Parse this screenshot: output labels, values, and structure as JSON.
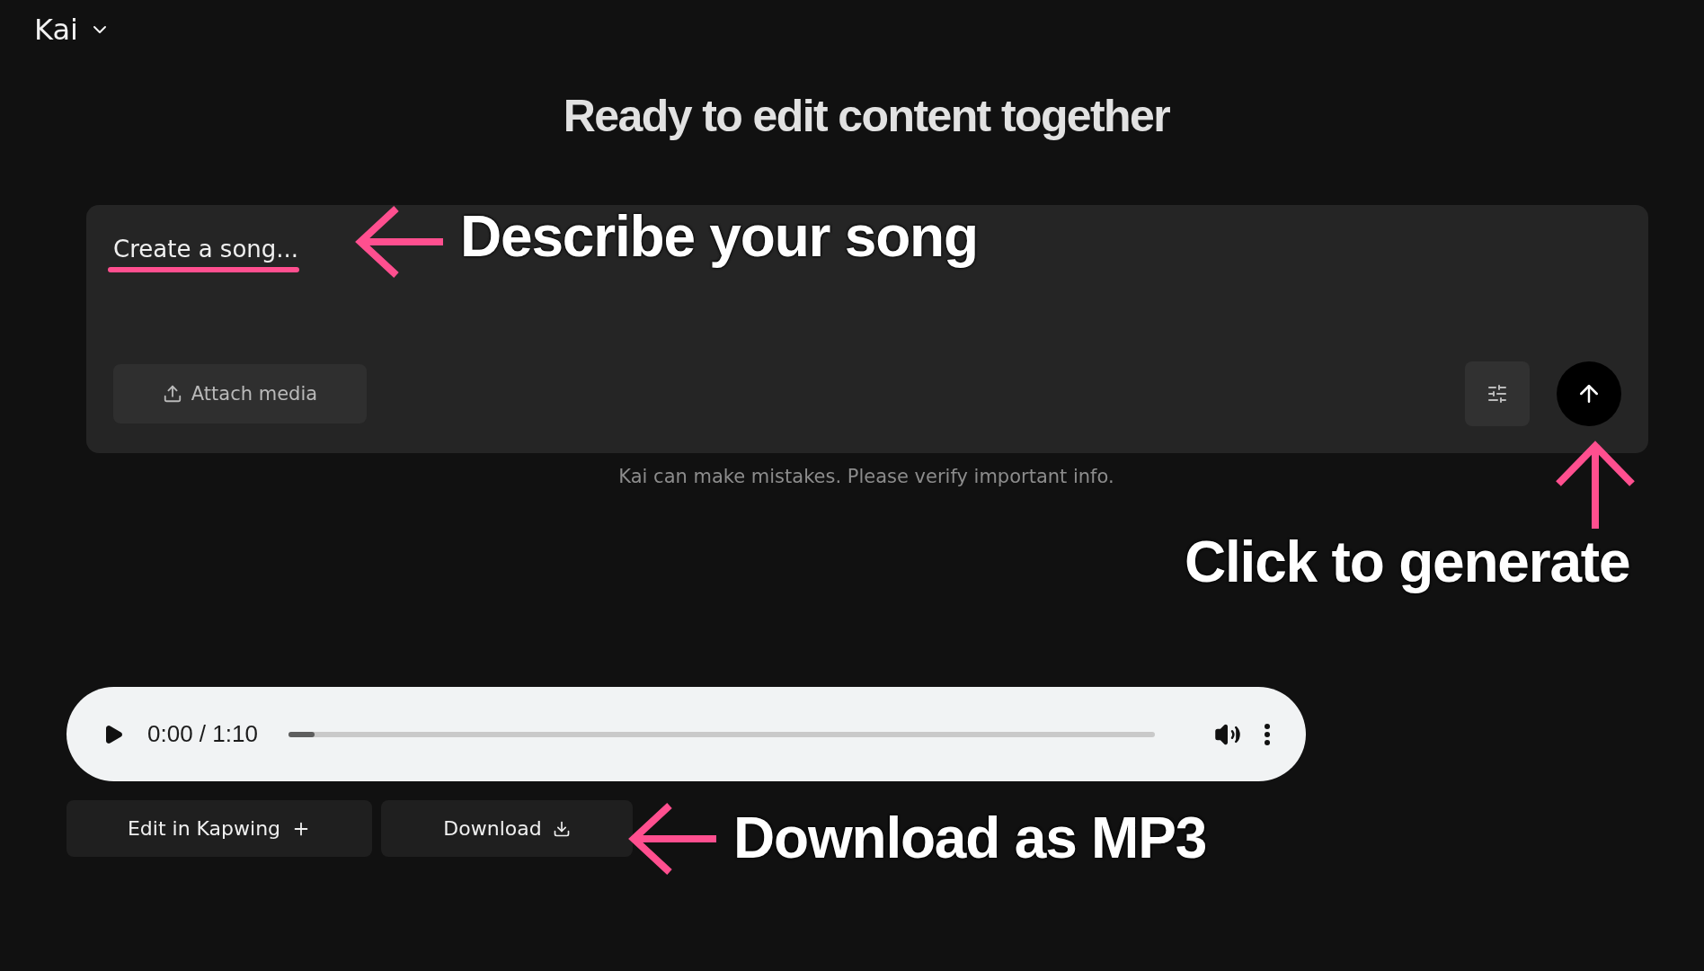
{
  "header": {
    "title": "Kai"
  },
  "heading": "Ready to edit content together",
  "prompt": {
    "placeholder": "Create a song...",
    "attach_button": "Attach media"
  },
  "disclaimer": "Kai can make mistakes. Please verify important info.",
  "player": {
    "time": "0:00 / 1:10",
    "level": 0.03
  },
  "actions": [
    {
      "label": "Edit in Kapwing",
      "kind": "edit"
    },
    {
      "label": "Download",
      "kind": "download"
    }
  ],
  "annotations": [
    {
      "text": "Describe your song",
      "kind": "prompt"
    },
    {
      "text": "Click to generate",
      "kind": "generate"
    },
    {
      "text": "Download as MP3",
      "kind": "download"
    }
  ]
}
